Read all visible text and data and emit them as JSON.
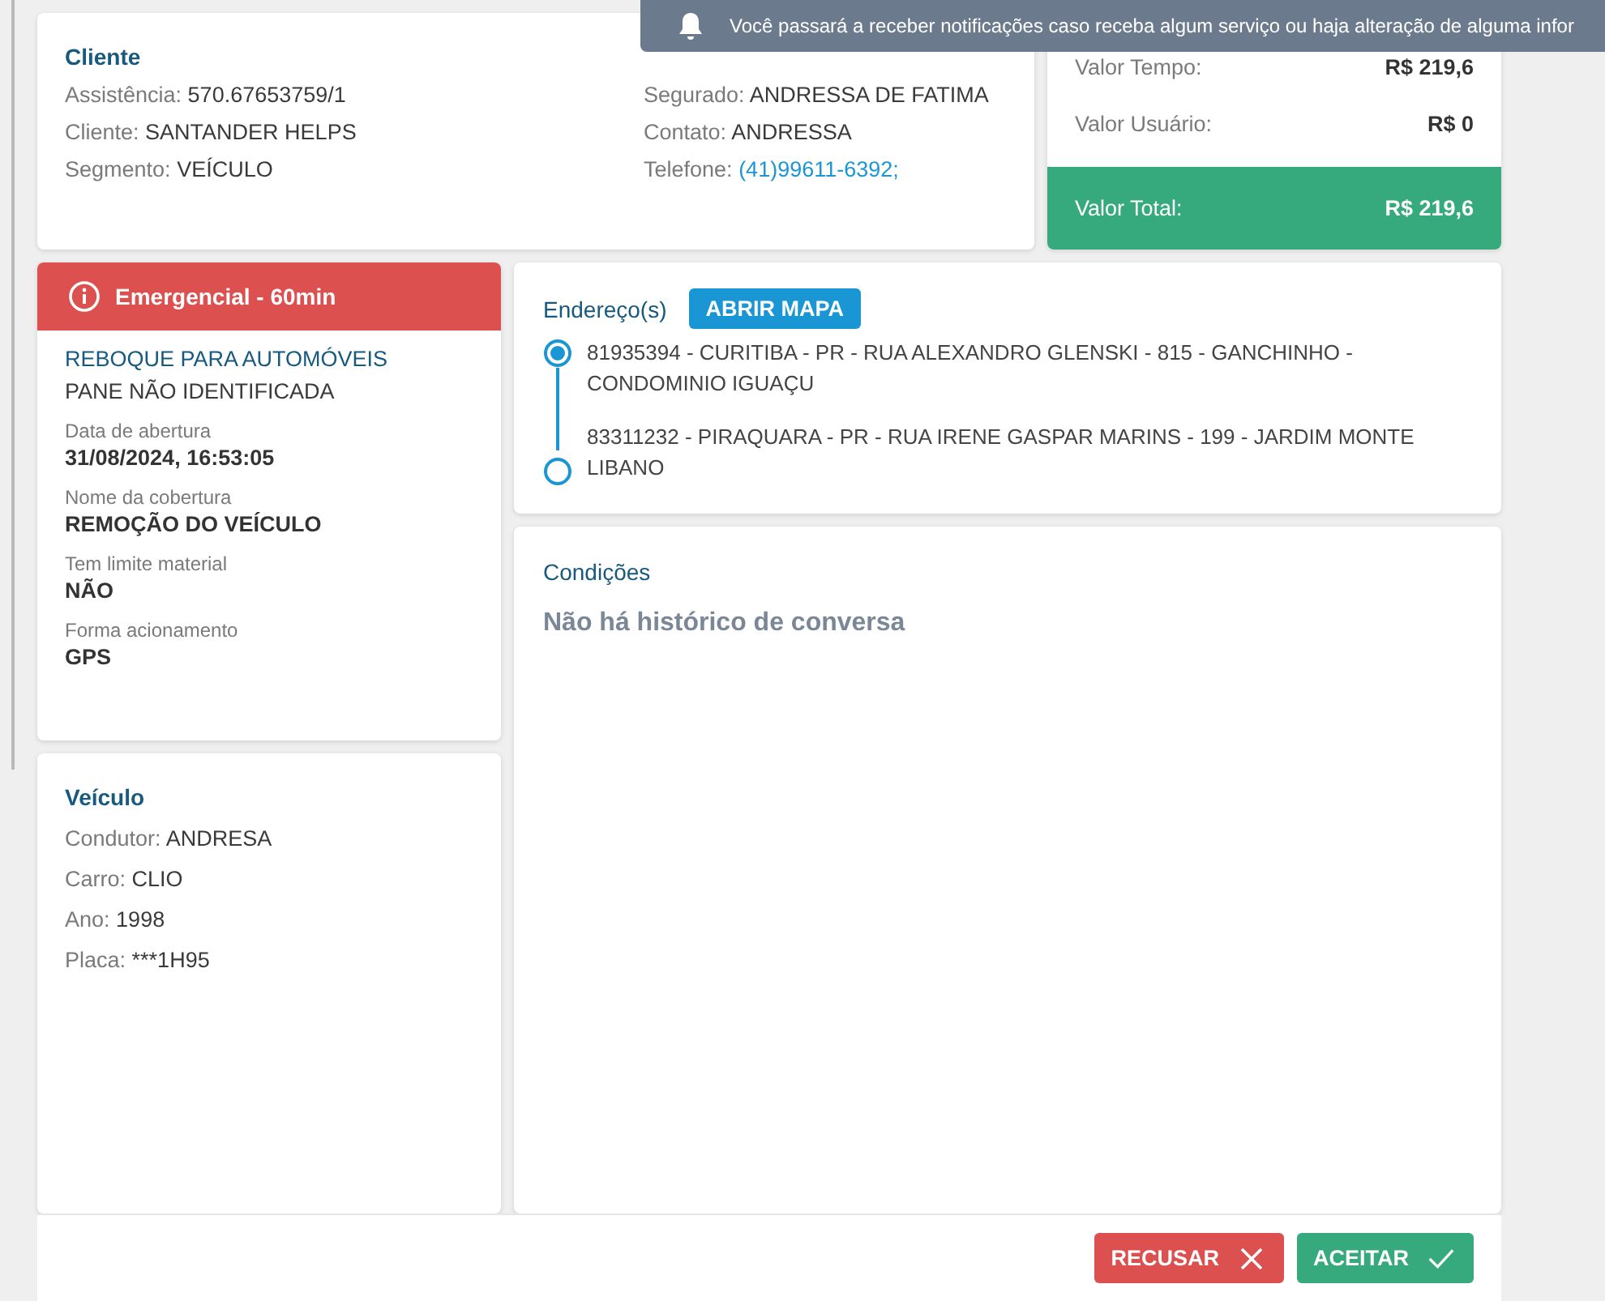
{
  "toast": {
    "text": "Você passará a receber notificações caso receba algum serviço ou haja alteração de alguma infor"
  },
  "client": {
    "title": "Cliente",
    "left": [
      {
        "label": "Assistência:",
        "value": "570.67653759/1",
        "link": false
      },
      {
        "label": "Cliente:",
        "value": "SANTANDER HELPS",
        "link": false
      },
      {
        "label": "Segmento:",
        "value": "VEÍCULO",
        "link": false
      }
    ],
    "right": [
      {
        "label": "Segurado:",
        "value": "ANDRESSA DE FATIMA",
        "link": false
      },
      {
        "label": "Contato:",
        "value": "ANDRESSA",
        "link": false
      },
      {
        "label": "Telefone:",
        "value": "(41)99611-6392;",
        "link": true
      }
    ]
  },
  "values": [
    {
      "label": "Valor Tempo:",
      "amount": "R$ 219,6",
      "total": false
    },
    {
      "label": "Valor Usuário:",
      "amount": "R$ 0",
      "total": false
    },
    {
      "label": "Valor Total:",
      "amount": "R$ 219,6",
      "total": true
    }
  ],
  "service": {
    "priority": "Emergencial - 60min",
    "type": "REBOQUE PARA AUTOMÓVEIS",
    "problem": "PANE NÃO IDENTIFICADA",
    "fields": [
      {
        "label": "Data de abertura",
        "value": "31/08/2024, 16:53:05"
      },
      {
        "label": "Nome da cobertura",
        "value": "REMOÇÃO DO VEÍCULO"
      },
      {
        "label": "Tem limite material",
        "value": "NÃO"
      },
      {
        "label": "Forma acionamento",
        "value": "GPS"
      }
    ]
  },
  "vehicle": {
    "title": "Veículo",
    "fields": [
      {
        "label": "Condutor:",
        "value": "ANDRESA"
      },
      {
        "label": "Carro:",
        "value": "CLIO"
      },
      {
        "label": "Ano:",
        "value": "1998"
      },
      {
        "label": "Placa:",
        "value": "***1H95"
      }
    ]
  },
  "addresses": {
    "title": "Endereço(s)",
    "map_button": "ABRIR MAPA",
    "items": [
      {
        "text": "81935394 - CURITIBA - PR - RUA ALEXANDRO GLENSKI - 815 - GANCHINHO - CONDOMINIO IGUAÇU",
        "kind": "origin"
      },
      {
        "text": "83311232 - PIRAQUARA - PR - RUA IRENE GASPAR MARINS - 199 - JARDIM MONTE LIBANO",
        "kind": "destination"
      }
    ]
  },
  "conditions": {
    "title": "Condições",
    "empty_text": "Não há histórico de conversa"
  },
  "buttons": [
    {
      "label": "RECUSAR",
      "kind": "reject"
    },
    {
      "label": "ACEITAR",
      "kind": "accept"
    }
  ]
}
